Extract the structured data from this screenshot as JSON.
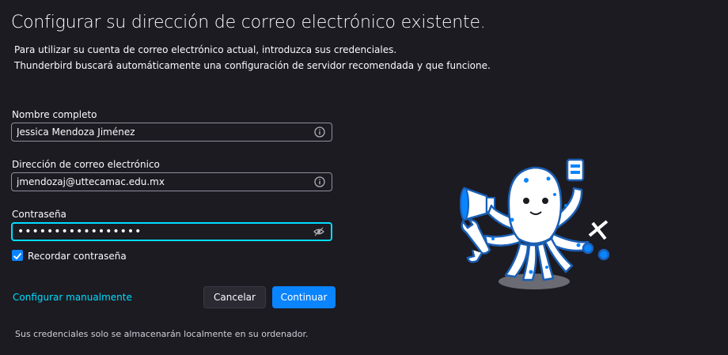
{
  "header": {
    "title": "Configurar su dirección de correo electrónico existente.",
    "desc_line1": "Para utilizar su cuenta de correo electrónico actual, introduzca sus credenciales.",
    "desc_line2": "Thunderbird buscará automáticamente una configuración de servidor recomendada y que funcione."
  },
  "form": {
    "name_label": "Nombre completo",
    "name_value": "Jessica Mendoza Jiménez",
    "email_label": "Dirección de correo electrónico",
    "email_value": "jmendozaj@uttecamac.edu.mx",
    "password_label": "Contraseña",
    "password_mask": "•••••••••••••••••",
    "remember_label": "Recordar contraseña",
    "remember_checked": true
  },
  "actions": {
    "manual_link": "Configurar manualmente",
    "cancel_label": "Cancelar",
    "continue_label": "Continuar"
  },
  "footer": {
    "note": "Sus credenciales solo se almacenarán localmente en su ordenador."
  },
  "icons": {
    "info": "info-icon",
    "eye": "eye-icon",
    "check": "checkmark-icon",
    "mascot": "octopus-mascot-illustration"
  },
  "colors": {
    "background": "#1c1b22",
    "accent_blue": "#0a84ff",
    "focus_cyan": "#00ddff",
    "link_cyan": "#00ddff"
  }
}
